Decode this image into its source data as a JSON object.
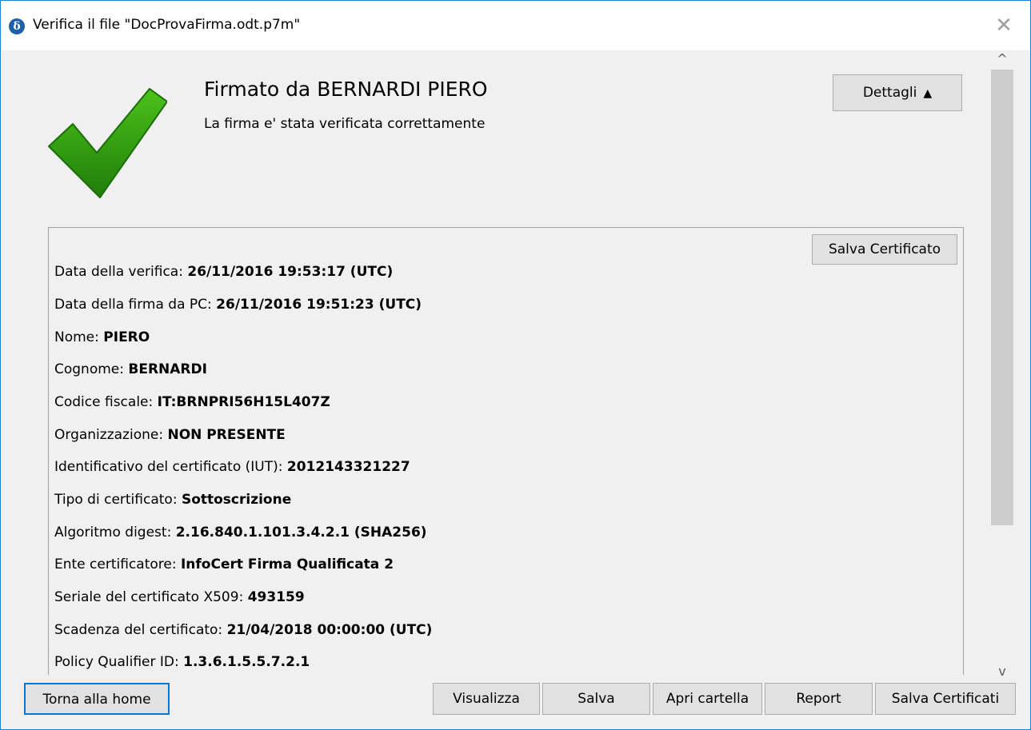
{
  "window": {
    "title": "Verifica il file \"DocProvaFirma.odt.p7m\"",
    "close_glyph": "✕",
    "app_icon_glyph": "δ",
    "accent": "#1883d7"
  },
  "header": {
    "title": "Firmato da BERNARDI PIERO",
    "subtitle": "La firma e' stata verificata correttamente",
    "details_button": "Dettagli",
    "details_arrow": "▲",
    "status_icon": "checkmark-icon",
    "status_color": "#2f9a0d"
  },
  "panel": {
    "save_certificate_button": "Salva Certificato",
    "rows": [
      {
        "label": "Data della verifica: ",
        "value": "26/11/2016 19:53:17 (UTC)"
      },
      {
        "label": "Data della firma da PC: ",
        "value": "26/11/2016 19:51:23 (UTC)"
      },
      {
        "label": "Nome: ",
        "value": "PIERO"
      },
      {
        "label": "Cognome: ",
        "value": "BERNARDI"
      },
      {
        "label": "Codice fiscale: ",
        "value": "IT:BRNPRI56H15L407Z"
      },
      {
        "label": "Organizzazione: ",
        "value": "NON PRESENTE"
      },
      {
        "label": "Identificativo del certificato (IUT): ",
        "value": "2012143321227"
      },
      {
        "label": "Tipo di certificato: ",
        "value": "Sottoscrizione"
      },
      {
        "label": "Algoritmo digest: ",
        "value": "2.16.840.1.101.3.4.2.1 (SHA256)"
      },
      {
        "label": "Ente certificatore: ",
        "value": "InfoCert Firma Qualificata 2"
      },
      {
        "label": "Seriale del certificato X509: ",
        "value": "493159"
      },
      {
        "label": "Scadenza del certificato: ",
        "value": "21/04/2018 00:00:00 (UTC)"
      },
      {
        "label": "Policy Qualifier ID: ",
        "value": "1.3.6.1.5.5.7.2.1"
      }
    ]
  },
  "scrollbar": {
    "up_glyph": "^",
    "down_glyph": "v"
  },
  "footer": {
    "home_button": "Torna alla home",
    "buttons": [
      "Visualizza",
      "Salva",
      "Apri cartella",
      "Report",
      "Salva Certificati"
    ]
  }
}
